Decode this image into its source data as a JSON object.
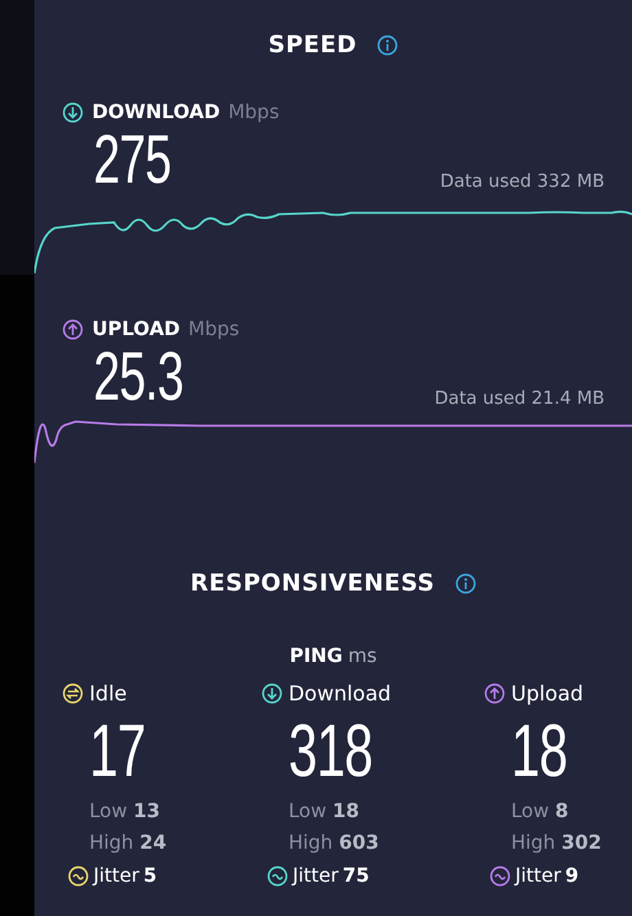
{
  "speed": {
    "title": "SPEED",
    "tests": [
      {
        "kind": "download",
        "label": "DOWNLOAD",
        "unit": "Mbps",
        "value": "275",
        "data_used": "Data used 332 MB",
        "color": "#56d6cc"
      },
      {
        "kind": "upload",
        "label": "UPLOAD",
        "unit": "Mbps",
        "value": "25.3",
        "data_used": "Data used 21.4 MB",
        "color": "#b77be8"
      }
    ]
  },
  "responsiveness": {
    "title": "RESPONSIVENESS",
    "ping": {
      "label": "PING",
      "unit": "ms"
    },
    "columns": [
      {
        "kind": "idle",
        "label": "Idle",
        "value": "17",
        "low_label": "Low",
        "low": "13",
        "high_label": "High",
        "high": "24",
        "jitter_label": "Jitter",
        "jitter": "5",
        "color": "#e8d66c"
      },
      {
        "kind": "download",
        "label": "Download",
        "value": "318",
        "low_label": "Low",
        "low": "18",
        "high_label": "High",
        "high": "603",
        "jitter_label": "Jitter",
        "jitter": "75",
        "color": "#56d6cc"
      },
      {
        "kind": "upload",
        "label": "Upload",
        "value": "18",
        "low_label": "Low",
        "low": "8",
        "high_label": "High",
        "high": "302",
        "jitter_label": "Jitter",
        "jitter": "9",
        "color": "#b77be8"
      }
    ]
  }
}
